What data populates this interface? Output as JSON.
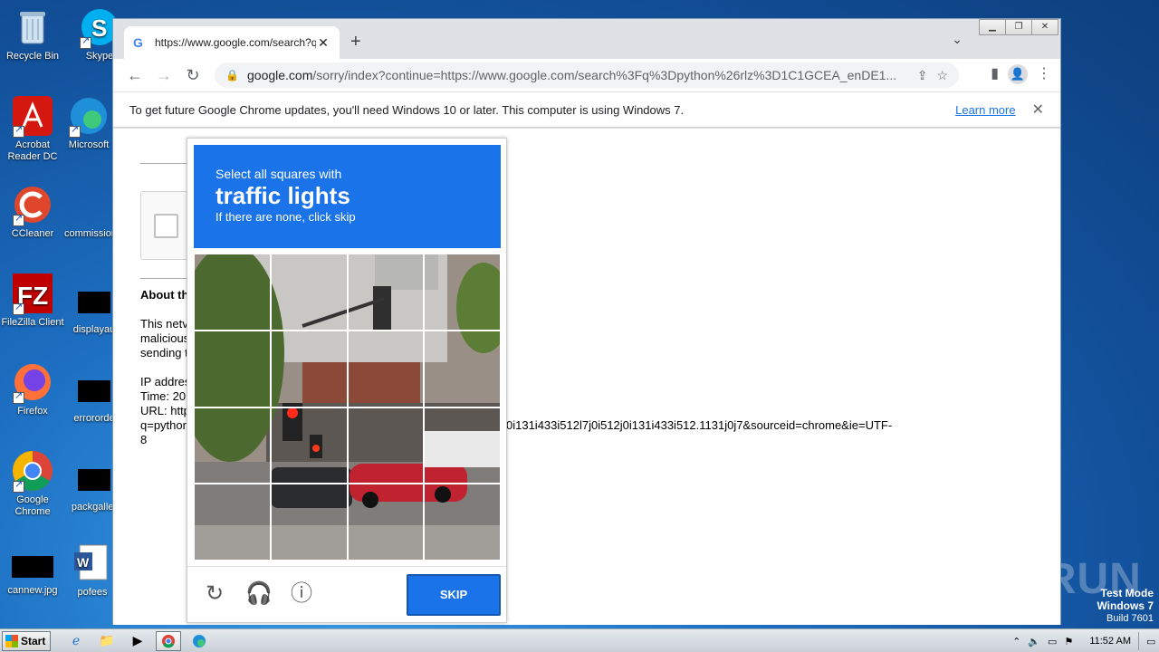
{
  "desktop": {
    "icons": [
      {
        "label": "Recycle Bin",
        "icon": "recycle-bin-icon"
      },
      {
        "label": "Acrobat Reader DC",
        "icon": "acrobat-icon"
      },
      {
        "label": "CCleaner",
        "icon": "ccleaner-icon"
      },
      {
        "label": "FileZilla Client",
        "icon": "filezilla-icon"
      },
      {
        "label": "Firefox",
        "icon": "firefox-icon"
      },
      {
        "label": "Google Chrome",
        "icon": "chrome-icon"
      },
      {
        "label": "cannew.jpg",
        "icon": "image-file-icon"
      },
      {
        "label": "Skype",
        "icon": "skype-icon"
      },
      {
        "label": "Microsoft",
        "icon": "edge-icon"
      },
      {
        "label": "commission",
        "icon": "file-icon"
      },
      {
        "label": "displayau",
        "icon": "file-icon"
      },
      {
        "label": "errororde",
        "icon": "file-icon"
      },
      {
        "label": "packgaller",
        "icon": "file-icon"
      },
      {
        "label": "pofees",
        "icon": "word-doc-icon"
      }
    ],
    "watermark": "ANY RUN",
    "test_mode": {
      "line1": "Test Mode",
      "line2": "Windows 7",
      "line3": "Build 7601"
    }
  },
  "browser": {
    "tab_title": "https://www.google.com/search?q=",
    "url_host": "google.com",
    "url_path": "/sorry/index?continue=https://www.google.com/search%3Fq%3Dpython%26rlz%3D1C1GCEA_enDE1...",
    "infobar_message": "To get future Google Chrome updates, you'll need Windows 10 or later. This computer is using Windows 7.",
    "infobar_link": "Learn more"
  },
  "page": {
    "about_heading": "About th",
    "para_lines": [
      "This netv",
      "malicious",
      "sending t"
    ],
    "ip_line": "IP addres",
    "time_line": "Time: 20",
    "url_line": "URL: http",
    "url_cont": "q=pythor",
    "url_tail": "0i131i433i512l7j0i512j0i131i433i512.1131j0j7&sourceid=chrome&ie=UTF-",
    "url_last": "8"
  },
  "captcha": {
    "line1": "Select all squares with",
    "target": "traffic lights",
    "line3": "If there are none, click skip",
    "skip_label": "SKIP"
  },
  "taskbar": {
    "start_label": "Start",
    "clock": "11:52 AM"
  }
}
